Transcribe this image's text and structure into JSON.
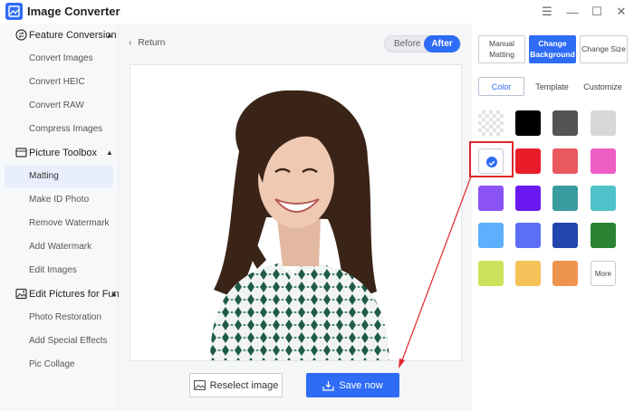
{
  "app": {
    "title": "Image Converter"
  },
  "window_controls": {
    "menu": "☰",
    "minimize": "—",
    "maximize": "☐",
    "close": "✕"
  },
  "sidebar": {
    "groups": [
      {
        "label": "Feature Conversion",
        "icon": "convert-icon",
        "items": [
          "Convert Images",
          "Convert HEIC",
          "Convert RAW",
          "Compress Images"
        ]
      },
      {
        "label": "Picture Toolbox",
        "icon": "toolbox-icon",
        "items": [
          "Matting",
          "Make ID Photo",
          "Remove Watermark",
          "Add Watermark",
          "Edit Images"
        ]
      },
      {
        "label": "Edit Pictures for Fun",
        "icon": "picture-fun-icon",
        "items": [
          "Photo Restoration",
          "Add Special Effects",
          "Pic Collage"
        ]
      }
    ],
    "active_item": "Matting"
  },
  "main": {
    "return_label": "Return",
    "toggle": {
      "before": "Before",
      "after": "After",
      "selected": "After"
    },
    "reselect_label": "Reselect image",
    "save_label": "Save now"
  },
  "right_panel": {
    "modes": [
      "Manual Matting",
      "Change Background",
      "Change Size"
    ],
    "active_mode": "Change Background",
    "tabs": [
      "Color",
      "Template",
      "Customize"
    ],
    "active_tab": "Color",
    "swatches": [
      "transparent",
      "#000000",
      "#545454",
      "#d8d8d8",
      "#ffffff",
      "#ea1c2a",
      "#ea5860",
      "#ef5ec5",
      "#8b52f6",
      "#6a18f0",
      "#3a9b9e",
      "#50c2c9",
      "#5db0fb",
      "#5c6ef7",
      "#2146ad",
      "#2a8332",
      "#cbe35a",
      "#f5c25a",
      "#ef9450"
    ],
    "selected_swatch": "#ffffff",
    "more_label": "More"
  },
  "colors": {
    "accent": "#2e6cf6",
    "annotation": "#e0262c",
    "sidebar_bg": "#f7f8fa"
  }
}
